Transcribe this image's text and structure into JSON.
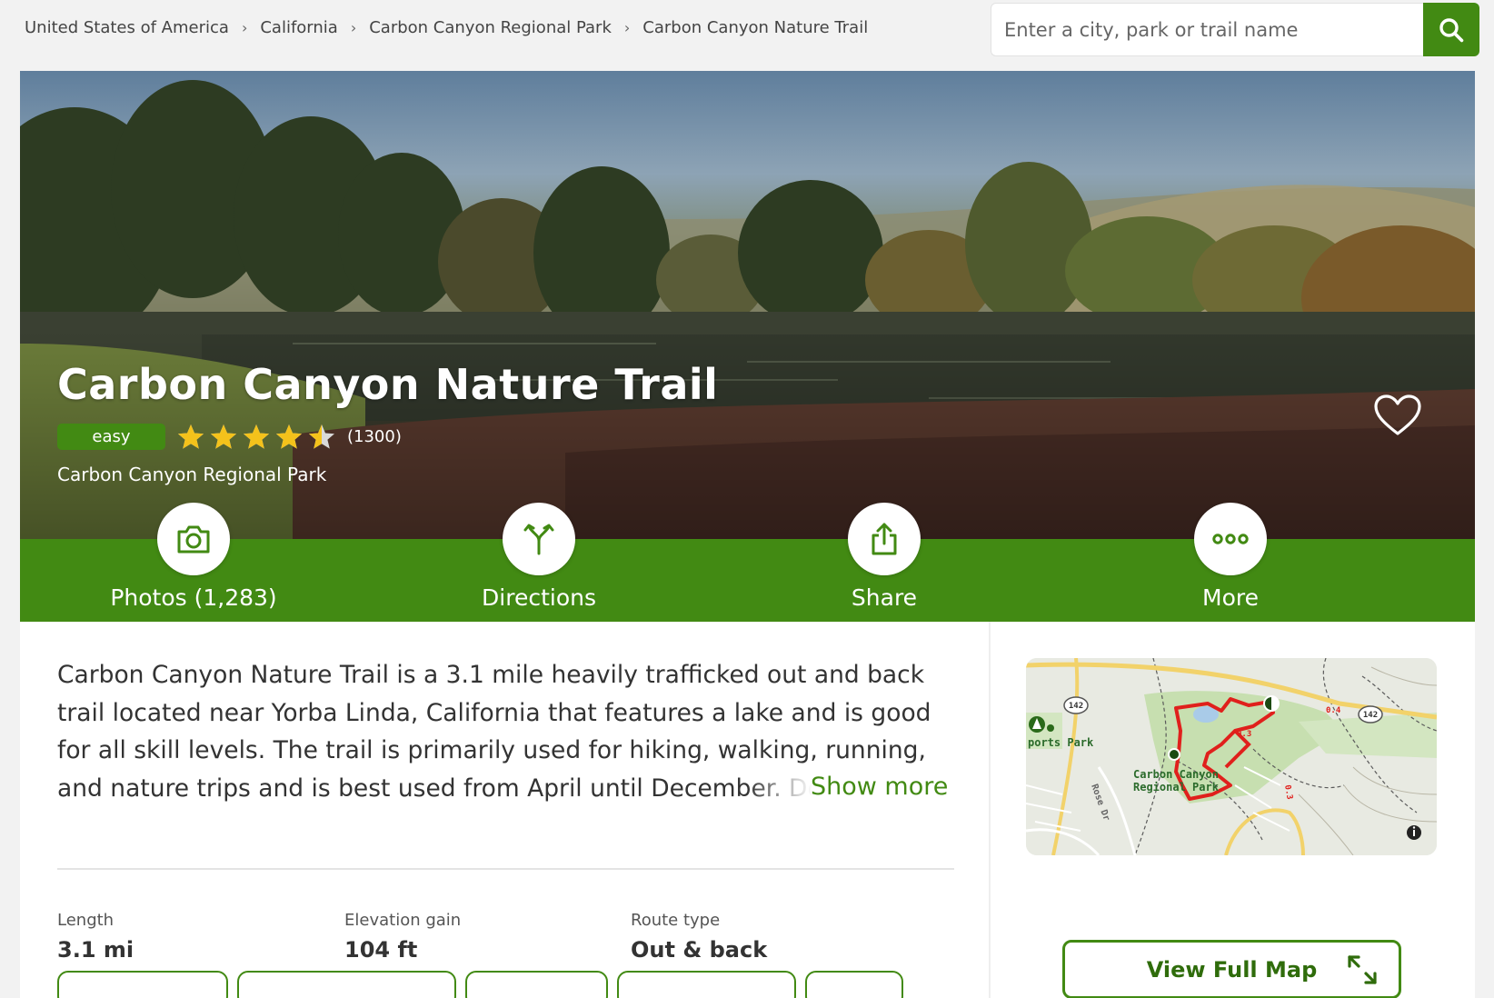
{
  "breadcrumb": {
    "items": [
      "United States of America",
      "California",
      "Carbon Canyon Regional Park",
      "Carbon Canyon Nature Trail"
    ],
    "separator": "›"
  },
  "search": {
    "placeholder": "Enter a city, park or trail name",
    "value": ""
  },
  "trail": {
    "title": "Carbon Canyon Nature Trail",
    "difficulty": "easy",
    "rating": 4.5,
    "rating_max": 5,
    "review_count": "(1300)",
    "park": "Carbon Canyon Regional Park"
  },
  "actions": [
    {
      "label": "Photos (1,283)",
      "icon": "camera-icon"
    },
    {
      "label": "Directions",
      "icon": "directions-icon"
    },
    {
      "label": "Share",
      "icon": "share-icon"
    },
    {
      "label": "More",
      "icon": "more-dots-icon"
    }
  ],
  "description": {
    "text": "Carbon Canyon Nature Trail is a 3.1 mile heavily trafficked out and back trail located near Yorba Linda, California that features a lake and is good for all skill levels. The trail is primarily used for hiking, walking, running, and nature trips and is best used from April until December. Dogs are also",
    "show_more": "Show more"
  },
  "stats": {
    "length": {
      "label": "Length",
      "value": "3.1 mi"
    },
    "elevation": {
      "label": "Elevation gain",
      "value": "104 ft"
    },
    "route": {
      "label": "Route type",
      "value": "Out & back"
    }
  },
  "map": {
    "labels": [
      "142",
      "142",
      "ports Park",
      "Carbon Canyon",
      "Regional Park",
      "Rose Dr",
      "0.4",
      "0.3",
      "0.3"
    ],
    "view_full_map": "View Full Map"
  },
  "colors": {
    "brand_green": "#428a13",
    "star": "#f4c21b",
    "route_red": "#e0201c"
  }
}
